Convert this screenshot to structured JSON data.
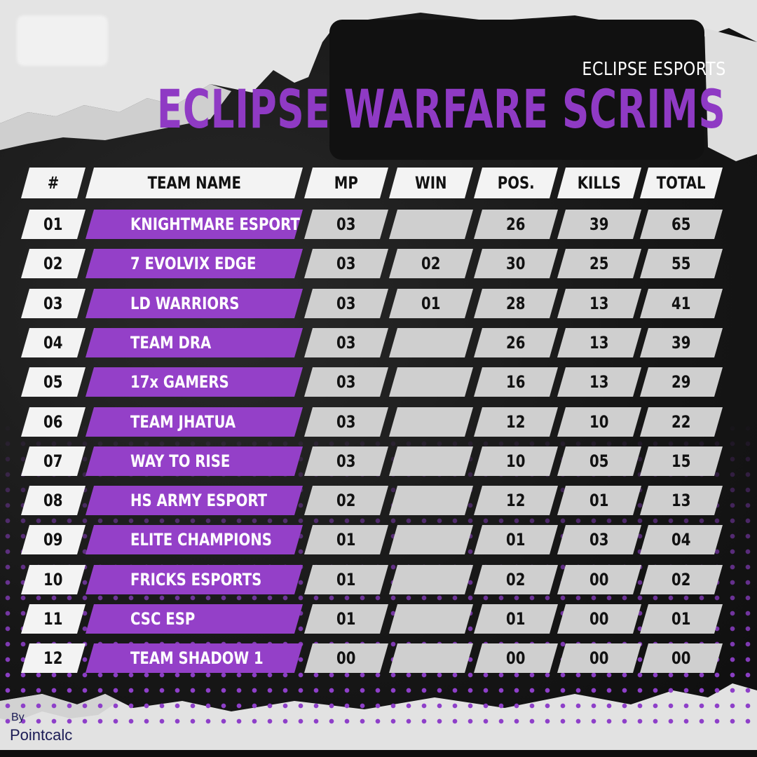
{
  "header": {
    "organizer": "ECLIPSE ESPORTS",
    "title": "ECLIPSE WARFARE SCRIMS"
  },
  "table": {
    "columns": [
      "#",
      "TEAM NAME",
      "MP",
      "WIN",
      "POS.",
      "KILLS",
      "TOTAL"
    ],
    "rows": [
      {
        "rank": "01",
        "team": "KNIGHTMARE ESPORTS",
        "mp": "03",
        "win": "",
        "pos": "26",
        "kills": "39",
        "total": "65"
      },
      {
        "rank": "02",
        "team": "7 EVOLVIX EDGE",
        "mp": "03",
        "win": "02",
        "pos": "30",
        "kills": "25",
        "total": "55"
      },
      {
        "rank": "03",
        "team": "LD WARRIORS",
        "mp": "03",
        "win": "01",
        "pos": "28",
        "kills": "13",
        "total": "41"
      },
      {
        "rank": "04",
        "team": "TEAM DRA",
        "mp": "03",
        "win": "",
        "pos": "26",
        "kills": "13",
        "total": "39"
      },
      {
        "rank": "05",
        "team": "17x GAMERS",
        "mp": "03",
        "win": "",
        "pos": "16",
        "kills": "13",
        "total": "29"
      },
      {
        "rank": "06",
        "team": "TEAM JHATUA",
        "mp": "03",
        "win": "",
        "pos": "12",
        "kills": "10",
        "total": "22"
      },
      {
        "rank": "07",
        "team": "WAY TO RISE",
        "mp": "03",
        "win": "",
        "pos": "10",
        "kills": "05",
        "total": "15"
      },
      {
        "rank": "08",
        "team": "HS ARMY ESPORT",
        "mp": "02",
        "win": "",
        "pos": "12",
        "kills": "01",
        "total": "13"
      },
      {
        "rank": "09",
        "team": "ELITE CHAMPIONS",
        "mp": "01",
        "win": "",
        "pos": "01",
        "kills": "03",
        "total": "04"
      },
      {
        "rank": "10",
        "team": "FRICKS ESPORTS",
        "mp": "01",
        "win": "",
        "pos": "02",
        "kills": "00",
        "total": "02"
      },
      {
        "rank": "11",
        "team": "CSC ESP",
        "mp": "01",
        "win": "",
        "pos": "01",
        "kills": "00",
        "total": "01"
      },
      {
        "rank": "12",
        "team": "TEAM SHADOW 1",
        "mp": "00",
        "win": "",
        "pos": "00",
        "kills": "00",
        "total": "00"
      }
    ]
  },
  "credit": {
    "by": "By",
    "name": "Pointcalc"
  },
  "colors": {
    "accent": "#9440c8",
    "title": "#8f3ac4",
    "cell_grey": "#cfcfcf",
    "cell_white": "#f3f3f3"
  }
}
